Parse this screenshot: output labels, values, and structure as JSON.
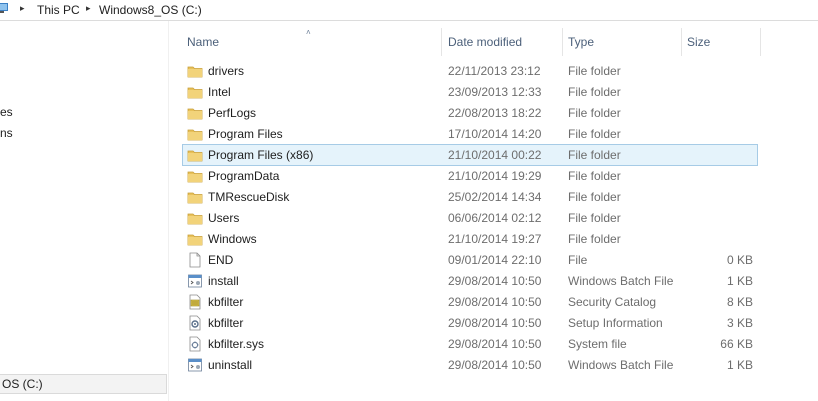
{
  "address": {
    "crumbs": [
      "This PC",
      "Windows8_OS (C:)"
    ],
    "separator_glyph": "▸"
  },
  "nav": {
    "fragments": [
      "es",
      "ns"
    ],
    "selected_drive": "OS (C:)"
  },
  "columns": {
    "name": "Name",
    "date": "Date modified",
    "type": "Type",
    "size": "Size",
    "sort_glyph": "˄"
  },
  "files": [
    {
      "name": "drivers",
      "date": "22/11/2013 23:12",
      "type": "File folder",
      "size": "",
      "icon": "folder-icon"
    },
    {
      "name": "Intel",
      "date": "23/09/2013 12:33",
      "type": "File folder",
      "size": "",
      "icon": "folder-icon"
    },
    {
      "name": "PerfLogs",
      "date": "22/08/2013 18:22",
      "type": "File folder",
      "size": "",
      "icon": "folder-icon"
    },
    {
      "name": "Program Files",
      "date": "17/10/2014 14:20",
      "type": "File folder",
      "size": "",
      "icon": "folder-icon"
    },
    {
      "name": "Program Files (x86)",
      "date": "21/10/2014 00:22",
      "type": "File folder",
      "size": "",
      "icon": "folder-icon",
      "selected": true
    },
    {
      "name": "ProgramData",
      "date": "21/10/2014 19:29",
      "type": "File folder",
      "size": "",
      "icon": "folder-icon"
    },
    {
      "name": "TMRescueDisk",
      "date": "25/02/2014 14:34",
      "type": "File folder",
      "size": "",
      "icon": "folder-icon"
    },
    {
      "name": "Users",
      "date": "06/06/2014 02:12",
      "type": "File folder",
      "size": "",
      "icon": "folder-icon"
    },
    {
      "name": "Windows",
      "date": "21/10/2014 19:27",
      "type": "File folder",
      "size": "",
      "icon": "folder-icon"
    },
    {
      "name": "END",
      "date": "09/01/2014 22:10",
      "type": "File",
      "size": "0 KB",
      "icon": "file-icon"
    },
    {
      "name": "install",
      "date": "29/08/2014 10:50",
      "type": "Windows Batch File",
      "size": "1 KB",
      "icon": "batch-file-icon"
    },
    {
      "name": "kbfilter",
      "date": "29/08/2014 10:50",
      "type": "Security Catalog",
      "size": "8 KB",
      "icon": "security-catalog-icon"
    },
    {
      "name": "kbfilter",
      "date": "29/08/2014 10:50",
      "type": "Setup Information",
      "size": "3 KB",
      "icon": "setup-info-icon"
    },
    {
      "name": "kbfilter.sys",
      "date": "29/08/2014 10:50",
      "type": "System file",
      "size": "66 KB",
      "icon": "system-file-icon"
    },
    {
      "name": "uninstall",
      "date": "29/08/2014 10:50",
      "type": "Windows Batch File",
      "size": "1 KB",
      "icon": "batch-file-icon"
    }
  ],
  "colors": {
    "selection_bg": "#e5f3fb",
    "selection_border": "#a6cbe6",
    "header_text": "#4c607a",
    "detail_text": "#6d6d6d",
    "folder": "#e8c15a"
  }
}
